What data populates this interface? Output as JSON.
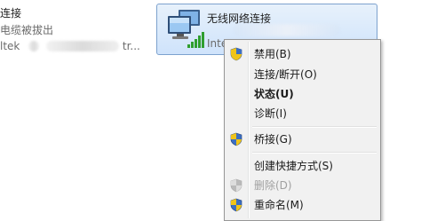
{
  "left_connection": {
    "name": "连接",
    "status": "电缆被拔出",
    "adapter_prefix": "ltek",
    "adapter_suffix": "tr..."
  },
  "wireless_connection": {
    "title": "无线网络连接",
    "adapter_prefix": "Inte"
  },
  "context_menu": {
    "items": [
      {
        "label": "禁用(B)",
        "shield": true,
        "bold": false,
        "disabled": false
      },
      {
        "label": "连接/断开(O)",
        "shield": false,
        "bold": false,
        "disabled": false
      },
      {
        "label": "状态(U)",
        "shield": false,
        "bold": true,
        "disabled": false
      },
      {
        "label": "诊断(I)",
        "shield": false,
        "bold": false,
        "disabled": false
      },
      {
        "label": "桥接(G)",
        "shield": true,
        "bold": false,
        "disabled": false
      },
      {
        "label": "创建快捷方式(S)",
        "shield": false,
        "bold": false,
        "disabled": false
      },
      {
        "label": "删除(D)",
        "shield": true,
        "bold": false,
        "disabled": true
      },
      {
        "label": "重命名(M)",
        "shield": true,
        "bold": false,
        "disabled": false
      }
    ]
  },
  "colors": {
    "selection_border": "#7da2ce",
    "selection_fill": "#cfe3fb",
    "menu_background": "#f1f1f1",
    "disabled_text": "#a0a0a0"
  }
}
